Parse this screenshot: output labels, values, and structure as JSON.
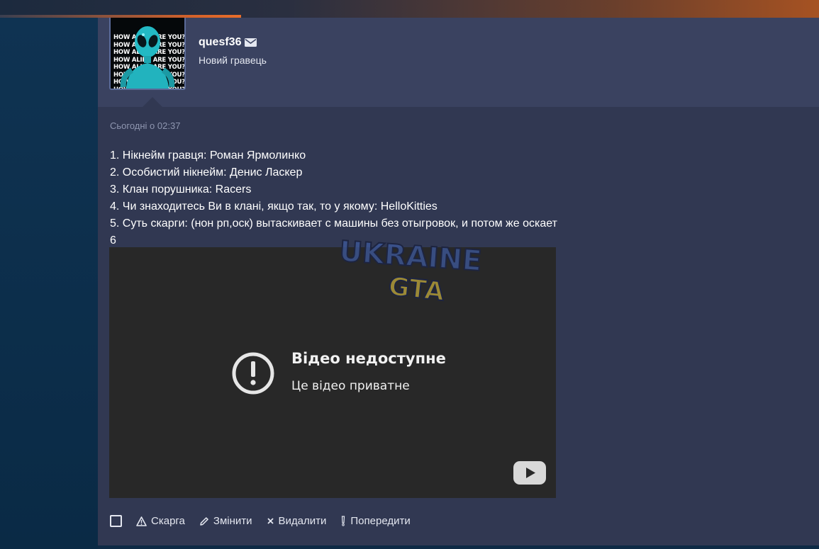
{
  "user": {
    "name": "quesf36",
    "title": "Новий гравець",
    "avatar_text": "HOW ALIEN ARE YOU?"
  },
  "post": {
    "timestamp": "Сьогодні о 02:37",
    "lines": [
      "1. Нікнейм гравця: Роман Ярмолинко",
      "2. Особистий нікнейм: Денис Ласкер",
      "3. Клан порушника: Racers",
      "4. Чи знаходитесь Ви в клані, якщо так, то у якому: HelloKitties",
      "5. Суть скарги: (нон рп,оск) вытаскивает с машины без отыгровок, и потом же оскает",
      "6"
    ]
  },
  "video": {
    "title": "Відео недоступне",
    "subtitle": "Це відео приватне",
    "watermark_line1": "UKRAINE",
    "watermark_line2": "GTA"
  },
  "actions": {
    "report": "Скарга",
    "edit": "Змінити",
    "delete": "Видалити",
    "warn": "Попередити"
  },
  "colors": {
    "page_bg": "#0e2a45",
    "post_bg": "#313852",
    "header_bg": "#3a4260",
    "video_bg": "#282828",
    "accent_orange": "#e86d2a"
  }
}
